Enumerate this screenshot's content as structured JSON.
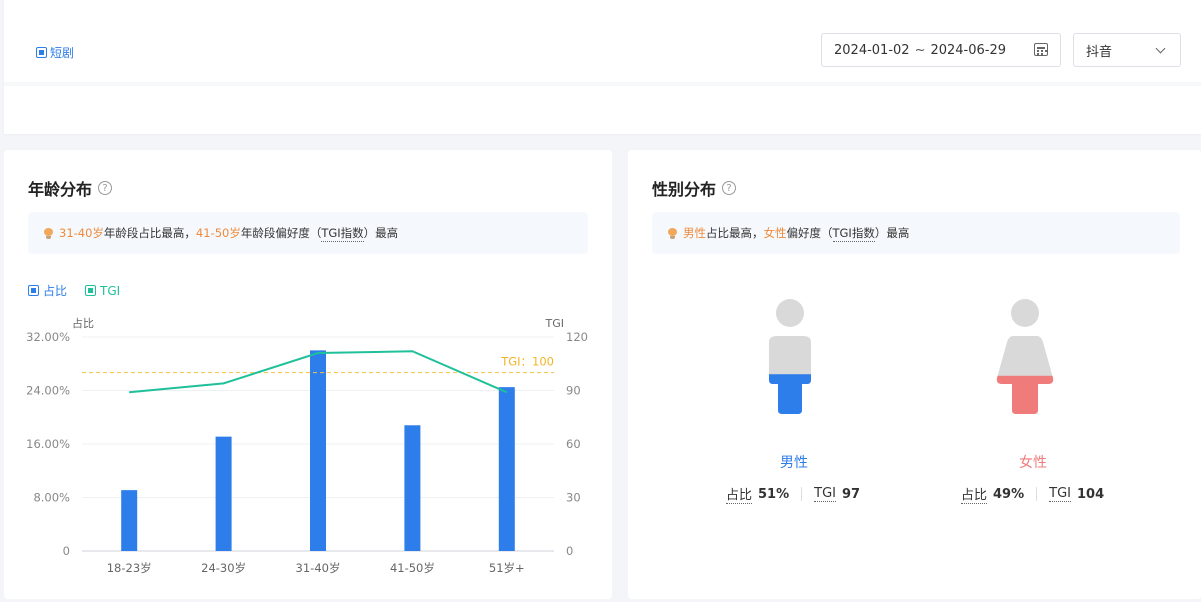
{
  "filter": {
    "tag_label": "短剧",
    "date_start": "2024-01-02",
    "date_sep": "~",
    "date_end": "2024-06-29",
    "platform": "抖音"
  },
  "age_card": {
    "title": "年龄分布",
    "help": "?",
    "insight": {
      "highlight1": "31-40岁",
      "text1": "年龄段占比最高，",
      "highlight2": "41-50岁",
      "text2": "年龄段偏好度（",
      "term": "TGI指数",
      "text3": "）最高"
    },
    "legend": {
      "share": "占比",
      "tgi": "TGI"
    }
  },
  "gender_card": {
    "title": "性别分布",
    "help": "?",
    "insight": {
      "highlight1": "男性",
      "text1": "占比最高，",
      "highlight2": "女性",
      "text2": "偏好度（",
      "term": "TGI指数",
      "text3": "）最高"
    },
    "male": {
      "name": "男性",
      "share_label": "占比",
      "share": "51%",
      "tgi_label": "TGI",
      "tgi": "97",
      "share_value": 0.51
    },
    "female": {
      "name": "女性",
      "share_label": "占比",
      "share": "49%",
      "tgi_label": "TGI",
      "tgi": "104",
      "share_value": 0.49
    }
  },
  "colors": {
    "bar": "#2d7dea",
    "tgi_line": "#1fc09a",
    "ref_line": "#f5c342",
    "male": "#2d7dea",
    "female": "#f07b7b",
    "figure_gray": "#d9d9d9"
  },
  "chart_data": {
    "type": "bar",
    "categories": [
      "18-23岁",
      "24-30岁",
      "31-40岁",
      "41-50岁",
      "51岁+"
    ],
    "series": [
      {
        "name": "占比",
        "axis": "left",
        "values": [
          9.1,
          17.1,
          30.0,
          18.8,
          24.5
        ]
      },
      {
        "name": "TGI",
        "axis": "right",
        "type": "line",
        "values": [
          89,
          94,
          111,
          112,
          89
        ]
      }
    ],
    "ylabel_left": "占比",
    "ylabel_right": "TGI",
    "yticks_left": [
      "0",
      "8.00%",
      "16.00%",
      "24.00%",
      "32.00%"
    ],
    "yticks_right": [
      "0",
      "30",
      "60",
      "90",
      "120"
    ],
    "ylim_left": [
      0,
      32
    ],
    "ylim_right": [
      0,
      120
    ],
    "reference_line": {
      "label": "TGI：100",
      "value": 100,
      "axis": "right"
    },
    "grid": true
  }
}
